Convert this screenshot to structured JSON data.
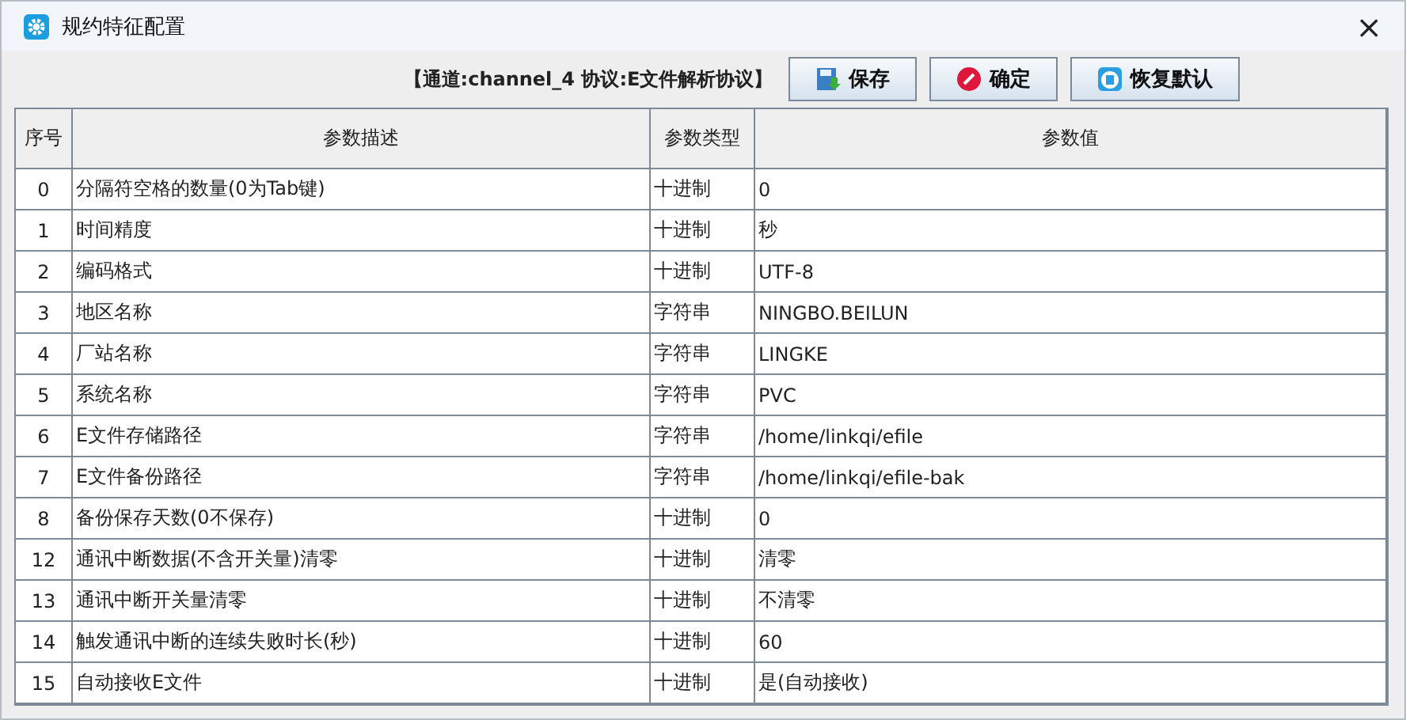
{
  "window": {
    "title": "规约特征配置",
    "close": "×"
  },
  "toolbar": {
    "info": "【通道:channel_4  协议:E文件解析协议】",
    "buttons": [
      {
        "kind": "save",
        "label": "保存"
      },
      {
        "kind": "ok",
        "label": "确定"
      },
      {
        "kind": "reset",
        "label": "恢复默认"
      }
    ]
  },
  "table": {
    "columns": [
      "序号",
      "参数描述",
      "参数类型",
      "参数值"
    ],
    "rows": [
      [
        "0",
        "分隔符空格的数量(0为Tab键)",
        "十进制",
        "0"
      ],
      [
        "1",
        "时间精度",
        "十进制",
        "秒"
      ],
      [
        "2",
        "编码格式",
        "十进制",
        "UTF-8"
      ],
      [
        "3",
        "地区名称",
        "字符串",
        "NINGBO.BEILUN"
      ],
      [
        "4",
        "厂站名称",
        "字符串",
        "LINGKE"
      ],
      [
        "5",
        "系统名称",
        "字符串",
        "PVC"
      ],
      [
        "6",
        "E文件存储路径",
        "字符串",
        "/home/linkqi/efile"
      ],
      [
        "7",
        "E文件备份路径",
        "字符串",
        "/home/linkqi/efile-bak"
      ],
      [
        "8",
        "备份保存天数(0不保存)",
        "十进制",
        "0"
      ],
      [
        "12",
        "通讯中断数据(不含开关量)清零",
        "十进制",
        "清零"
      ],
      [
        "13",
        "通讯中断开关量清零",
        "十进制",
        "不清零"
      ],
      [
        "14",
        "触发通讯中断的连续失败时长(秒)",
        "十进制",
        "60"
      ],
      [
        "15",
        "自动接收E文件",
        "十进制",
        "是(自动接收)"
      ]
    ]
  }
}
